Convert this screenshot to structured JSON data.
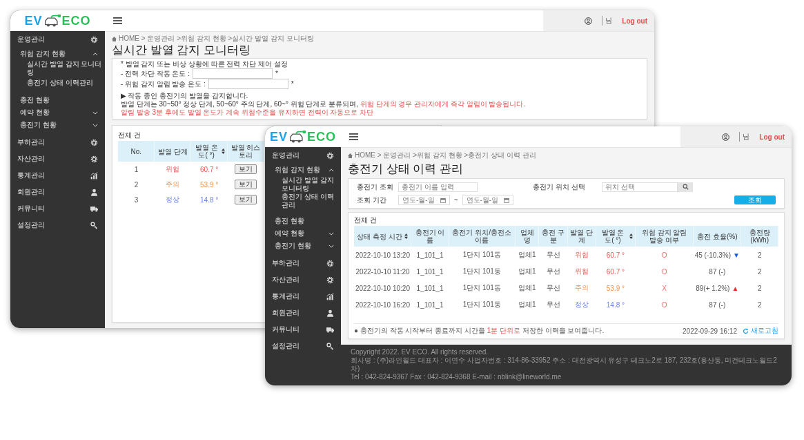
{
  "windows": [
    {
      "kind": "monitor",
      "logo": {
        "left": "EV",
        "right": "ECO"
      },
      "sidebar": {
        "items": [
          {
            "label": "운영관리",
            "kind": "gear",
            "children": [
              {
                "label": "위험 감지 현황",
                "expanded": true,
                "children": [
                  {
                    "label": "실시간 발열 감지 모니터링"
                  },
                  {
                    "label": "충전기 상태 이력관리"
                  }
                ]
              },
              {
                "label": "충전 현황"
              },
              {
                "label": "예약 현황",
                "expanded": false
              },
              {
                "label": "충전기 현황",
                "expanded": false
              }
            ]
          },
          {
            "label": "부하관리",
            "kind": "gear"
          },
          {
            "label": "자산관리",
            "kind": "gear"
          },
          {
            "label": "통계관리",
            "kind": "chart"
          },
          {
            "label": "회원관리",
            "kind": "person"
          },
          {
            "label": "커뮤니티",
            "kind": "truck"
          },
          {
            "label": "설정관리",
            "kind": "keys"
          }
        ]
      },
      "header": {
        "user_suffix": "님",
        "logout": "Log out"
      },
      "breadcrumb": "HOME > 운영관리 >위험 감지 현황 >실시간 발열 감지 모니터링",
      "title": "실시간 발열 감지 모니터링",
      "settings": {
        "heading": "* 발열 감지 또는 비상 상황에 따른 전력 차단 제어 설정",
        "fields": [
          {
            "label": "- 전력 차단 작동 온도 :",
            "mark": "*"
          },
          {
            "label": "- 위험 감지 알림 발송 온도 :",
            "mark": "*"
          }
        ],
        "notice": "▶ 작동 중인 충전기의 발열을 감지합니다.",
        "info": {
          "text": "발열 단계는 30~50° 정상 단계, 50~60° 주의 단계, 60~° 위험 단계로 분류되며, ",
          "highlight": "위험 단계의 경우 관리자에게 즉각 알림이 발송됩니다."
        },
        "warning": "알림 발송 3분 후에도 발열 온도가 계속 위험수준을 유지하면 전력이 자동으로 차단"
      },
      "table": {
        "total": "전체 건",
        "columns": [
          {
            "label": "No.",
            "kind": "plain"
          },
          {
            "label": "발열 단계",
            "kind": "stage"
          },
          {
            "label": "발열 온도( °)",
            "kind": "stage",
            "sortable": true
          },
          {
            "label": "발열 히스토리",
            "kind": "button"
          }
        ],
        "rows": [
          {
            "cells": [
              "1",
              "위험",
              "60.7 °",
              "보기"
            ],
            "kind": "danger"
          },
          {
            "cells": [
              "2",
              "주의",
              "53.9 °",
              "보기"
            ],
            "kind": "warning"
          },
          {
            "cells": [
              "3",
              "정상",
              "14.8 °",
              "보기"
            ],
            "kind": "normal"
          }
        ]
      }
    },
    {
      "kind": "history",
      "logo": {
        "left": "EV",
        "right": "ECO"
      },
      "sidebar": {
        "items": [
          {
            "label": "운영관리",
            "kind": "gear",
            "children": [
              {
                "label": "위험 감지 현황",
                "expanded": true,
                "children": [
                  {
                    "label": "실시간 발열 감지 모니터링"
                  },
                  {
                    "label": "충전기 상태 이력관리"
                  }
                ]
              },
              {
                "label": "충전 현황"
              },
              {
                "label": "예약 현황",
                "expanded": false
              },
              {
                "label": "충전기 현황",
                "expanded": false
              }
            ]
          },
          {
            "label": "부하관리",
            "kind": "gear"
          },
          {
            "label": "자산관리",
            "kind": "gear"
          },
          {
            "label": "통계관리",
            "kind": "chart"
          },
          {
            "label": "회원관리",
            "kind": "person"
          },
          {
            "label": "커뮤니티",
            "kind": "truck"
          },
          {
            "label": "설정관리",
            "kind": "keys"
          }
        ]
      },
      "header": {
        "user_suffix": "님",
        "logout": "Log out"
      },
      "breadcrumb": "HOME > 운영관리 >위험 감지 현황 >충전기 상태 이력 관리",
      "title": "충전기 상태 이력 관리",
      "search": {
        "name_label": "충전기 조회",
        "name_placeholder": "충전기 이름 입력",
        "location_label": "충전기 위치 선택",
        "location_placeholder": "위치 선택",
        "period_label": "조회 기간",
        "date_from": "연도-월-일",
        "separator": "~",
        "date_to": "연도-월-일",
        "submit": "조회"
      },
      "table": {
        "total": "전체 건",
        "columns": [
          {
            "label": "상태 측정 시간",
            "kind": "plain",
            "sortable": true
          },
          {
            "label": "충전기 이름",
            "kind": "plain"
          },
          {
            "label": "충전기 위치/충전소 이름",
            "kind": "plain"
          },
          {
            "label": "업체명",
            "kind": "plain"
          },
          {
            "label": "충전 구분",
            "kind": "plain"
          },
          {
            "label": "발열 단계",
            "kind": "stage"
          },
          {
            "label": "발열 온도( °)",
            "kind": "stage",
            "sortable": true
          },
          {
            "label": "위험 감지 알림 발송 여부",
            "kind": "alert"
          },
          {
            "label": "충전 효율(%)",
            "kind": "efficiency"
          },
          {
            "label": "충전량(kWh)",
            "kind": "plain"
          }
        ],
        "rows": [
          {
            "cells": [
              "2022-10-10 13:20",
              "1_101_1",
              "1단지 101동",
              "업체1",
              "무선",
              "위험",
              "60.7 °",
              "O",
              "45 (-10.3%)",
              "2"
            ],
            "kind": "danger",
            "trend": {
              "symbol": "▼",
              "color": "#1f5bd8"
            }
          },
          {
            "cells": [
              "2022-10-10 11:20",
              "1_101_1",
              "1단지 101동",
              "업체1",
              "무선",
              "위험",
              "60.7 °",
              "O",
              "87 (-)",
              "2"
            ],
            "kind": "danger"
          },
          {
            "cells": [
              "2022-10-10 10:20",
              "1_101_1",
              "1단지 101동",
              "업체1",
              "무선",
              "주의",
              "53.9 °",
              "X",
              "89(+ 1.2%)",
              "2"
            ],
            "kind": "warning",
            "trend": {
              "symbol": "▲",
              "color": "#e53030"
            }
          },
          {
            "cells": [
              "2022-10-10 16:20",
              "1_101_1",
              "1단지 101동",
              "업체1",
              "무선",
              "정상",
              "14.8 °",
              "O",
              "87 (-)",
              "2"
            ],
            "kind": "normal"
          }
        ]
      },
      "note": {
        "before": "● 충전기의 작동 시작부터 종료까지 시간을 ",
        "highlight": "1분 단위로",
        "after": " 저장한 이력을 보여줍니다."
      },
      "updated": "2022-09-29 16:12",
      "refresh": "새로고침",
      "footer": [
        "Copyright 2022. EV ECO. All rights reserved.",
        "회사명 : (주)라인월드 대표자 : 이연수 사업자번호 : 314-86-33952 주소 : 대전광역시 유성구 테크노2로 187, 232호(용산동, 미건테크노월드2차)",
        "Tel : 042-824-9367 Fax : 042-824-9368 E-mail : nblink@lineworld.me"
      ]
    }
  ]
}
